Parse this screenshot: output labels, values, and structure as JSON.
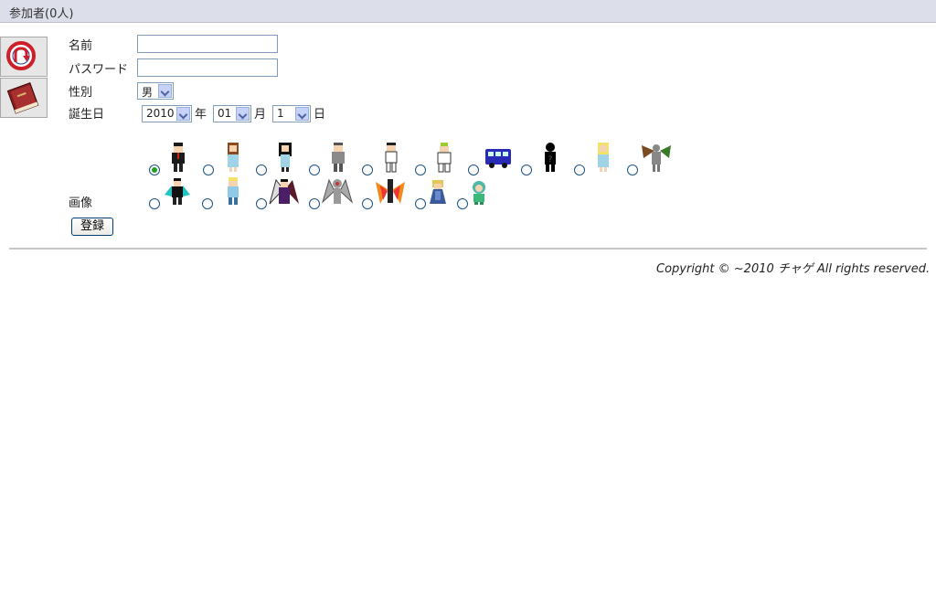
{
  "header": {
    "title": "参加者(0人)"
  },
  "sidebar": {
    "buttons": [
      {
        "name": "reload-button",
        "icon": "refresh-icon"
      },
      {
        "name": "book-button",
        "icon": "book-icon"
      }
    ]
  },
  "form": {
    "name_label": "名前",
    "name_value": "",
    "password_label": "パスワード",
    "password_value": "",
    "gender_label": "性別",
    "gender_value": "男",
    "birthday_label": "誕生日",
    "year_value": "2010",
    "year_unit": "年",
    "month_value": "01",
    "month_unit": "月",
    "day_value": "1",
    "day_unit": "日",
    "image_label": "画像",
    "selected_avatar_index": 0,
    "submit_label": "登録"
  },
  "avatars": {
    "row1": [
      "boy-black-hair",
      "girl-blue-dress",
      "girl-black-hair",
      "man-grey",
      "boy-white",
      "robot-white",
      "blue-bus",
      "silhouette-question",
      "blonde-girl",
      "winged-statue"
    ],
    "row2": [
      "vampire-caped",
      "blonde-boy",
      "dark-winged-lord",
      "grey-angel",
      "fire-phoenix",
      "blonde-cloaked",
      "green-slime-kid"
    ]
  },
  "footer": {
    "copyright": "Copyright © ~2010 チャゲ All rights reserved."
  }
}
